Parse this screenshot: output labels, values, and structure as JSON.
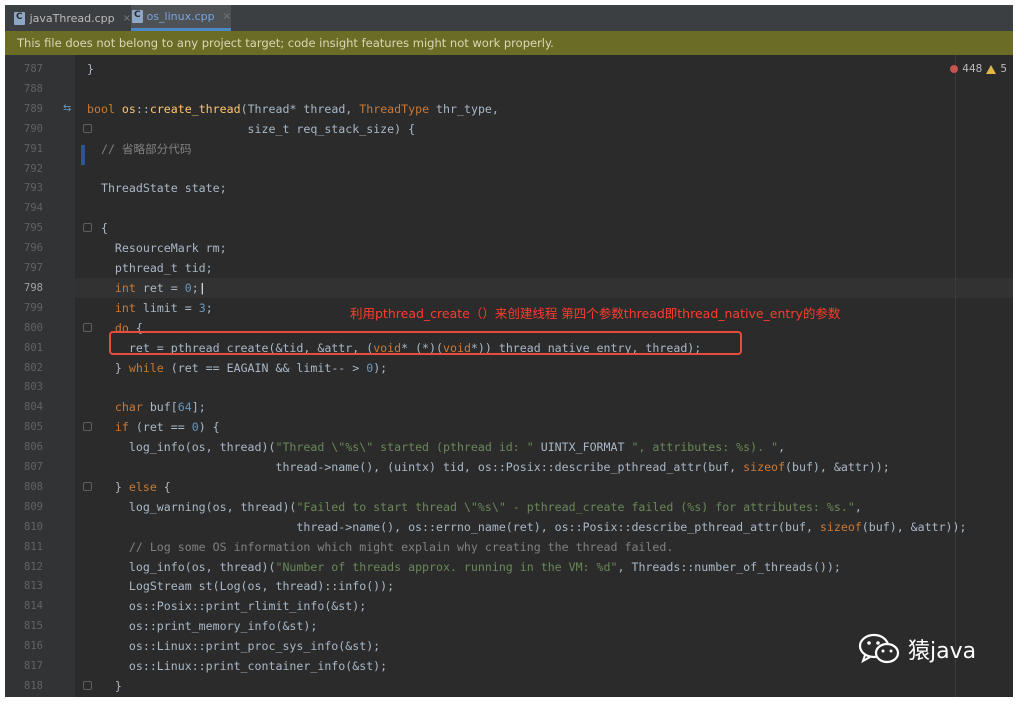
{
  "tabs": [
    {
      "label": "javaThread.cpp",
      "close": "×",
      "active": false
    },
    {
      "label": "os_linux.cpp",
      "close": "×",
      "active": true
    }
  ],
  "banner": "This file does not belong to any project target; code insight features might not work properly.",
  "inspection": {
    "errors": "448",
    "warnings": "5"
  },
  "current_line": "798",
  "lines": [
    {
      "n": "787",
      "segs": [
        [
          "plain",
          "}"
        ]
      ]
    },
    {
      "n": "788",
      "segs": []
    },
    {
      "n": "789",
      "segs": [
        [
          "kw",
          "bool "
        ],
        [
          "fn",
          "os"
        ],
        [
          "plain",
          "::"
        ],
        [
          "fn",
          "create_thread"
        ],
        [
          "plain",
          "(Thread* thread, "
        ],
        [
          "kw",
          "ThreadType"
        ],
        [
          "plain",
          " thr_type,"
        ]
      ]
    },
    {
      "n": "790",
      "segs": [
        [
          "plain",
          "                       size_t req_stack_size) {"
        ]
      ]
    },
    {
      "n": "791",
      "segs": [
        [
          "cmt",
          "  // 省略部分代码"
        ]
      ]
    },
    {
      "n": "792",
      "segs": []
    },
    {
      "n": "793",
      "segs": [
        [
          "plain",
          "  ThreadState state;"
        ]
      ]
    },
    {
      "n": "794",
      "segs": []
    },
    {
      "n": "795",
      "segs": [
        [
          "plain",
          "  {"
        ]
      ]
    },
    {
      "n": "796",
      "segs": [
        [
          "plain",
          "    ResourceMark rm;"
        ]
      ]
    },
    {
      "n": "797",
      "segs": [
        [
          "plain",
          "    pthread_t tid;"
        ]
      ]
    },
    {
      "n": "798",
      "segs": [
        [
          "kw",
          "    int"
        ],
        [
          "plain",
          " ret = "
        ],
        [
          "num",
          "0"
        ],
        [
          "plain",
          ";"
        ]
      ]
    },
    {
      "n": "799",
      "segs": [
        [
          "kw",
          "    int"
        ],
        [
          "plain",
          " limit = "
        ],
        [
          "num",
          "3"
        ],
        [
          "plain",
          ";"
        ]
      ]
    },
    {
      "n": "800",
      "segs": [
        [
          "kw",
          "    do"
        ],
        [
          "plain",
          " {"
        ]
      ]
    },
    {
      "n": "801",
      "segs": [
        [
          "plain",
          "      ret = pthread_create(&tid, &attr, ("
        ],
        [
          "kw",
          "void"
        ],
        [
          "plain",
          "* (*)("
        ],
        [
          "kw",
          "void"
        ],
        [
          "plain",
          "*)) thread_native_entry, thread);"
        ]
      ]
    },
    {
      "n": "802",
      "segs": [
        [
          "plain",
          "    } "
        ],
        [
          "kw",
          "while"
        ],
        [
          "plain",
          " (ret == EAGAIN && limit-- > "
        ],
        [
          "num",
          "0"
        ],
        [
          "plain",
          ");"
        ]
      ]
    },
    {
      "n": "803",
      "segs": []
    },
    {
      "n": "804",
      "segs": [
        [
          "kw",
          "    char"
        ],
        [
          "plain",
          " buf["
        ],
        [
          "num",
          "64"
        ],
        [
          "plain",
          "];"
        ]
      ]
    },
    {
      "n": "805",
      "segs": [
        [
          "kw",
          "    if"
        ],
        [
          "plain",
          " (ret == "
        ],
        [
          "num",
          "0"
        ],
        [
          "plain",
          ") {"
        ]
      ]
    },
    {
      "n": "806",
      "segs": [
        [
          "plain",
          "      log_info(os, thread)("
        ],
        [
          "str",
          "\"Thread \\\"%s\\\" started (pthread id: \""
        ],
        [
          "plain",
          " UINTX_FORMAT "
        ],
        [
          "str",
          "\", attributes: %s). \""
        ],
        [
          "plain",
          ","
        ]
      ]
    },
    {
      "n": "807",
      "segs": [
        [
          "plain",
          "                           thread->name(), (uintx) tid, os::Posix::describe_pthread_attr(buf, "
        ],
        [
          "kw",
          "sizeof"
        ],
        [
          "plain",
          "(buf), &attr));"
        ]
      ]
    },
    {
      "n": "808",
      "segs": [
        [
          "plain",
          "    } "
        ],
        [
          "kw",
          "else"
        ],
        [
          "plain",
          " {"
        ]
      ]
    },
    {
      "n": "809",
      "segs": [
        [
          "plain",
          "      log_warning(os, thread)("
        ],
        [
          "str",
          "\"Failed to start thread \\\"%s\\\" - pthread_create failed (%s) for attributes: %s.\""
        ],
        [
          "plain",
          ","
        ]
      ]
    },
    {
      "n": "810",
      "segs": [
        [
          "plain",
          "                              thread->name(), os::errno_name(ret), os::Posix::describe_pthread_attr(buf, "
        ],
        [
          "kw",
          "sizeof"
        ],
        [
          "plain",
          "(buf), &attr));"
        ]
      ]
    },
    {
      "n": "811",
      "segs": [
        [
          "cmt",
          "      // Log some OS information which might explain why creating the thread failed."
        ]
      ]
    },
    {
      "n": "812",
      "segs": [
        [
          "plain",
          "      log_info(os, thread)("
        ],
        [
          "str",
          "\"Number of threads approx. running in the VM: %d\""
        ],
        [
          "plain",
          ", Threads::number_of_threads());"
        ]
      ]
    },
    {
      "n": "813",
      "segs": [
        [
          "plain",
          "      LogStream st(Log(os, thread)::info());"
        ]
      ]
    },
    {
      "n": "814",
      "segs": [
        [
          "plain",
          "      os::Posix::print_rlimit_info(&st);"
        ]
      ]
    },
    {
      "n": "815",
      "segs": [
        [
          "plain",
          "      os::print_memory_info(&st);"
        ]
      ]
    },
    {
      "n": "816",
      "segs": [
        [
          "plain",
          "      os::Linux::print_proc_sys_info(&st);"
        ]
      ]
    },
    {
      "n": "817",
      "segs": [
        [
          "plain",
          "      os::Linux::print_container_info(&st);"
        ]
      ]
    },
    {
      "n": "818",
      "segs": [
        [
          "plain",
          "    }"
        ]
      ]
    }
  ],
  "annotation": "利用pthread_create（）来创建线程 第四个参数thread即thread_native_entry的参数",
  "watermark": "猿java",
  "colors": {
    "keyword": "#cc7832",
    "string": "#6a8759",
    "number": "#6897bb",
    "comment": "#808080",
    "banner": "#6b6d26",
    "annotation": "#e74c3c"
  }
}
